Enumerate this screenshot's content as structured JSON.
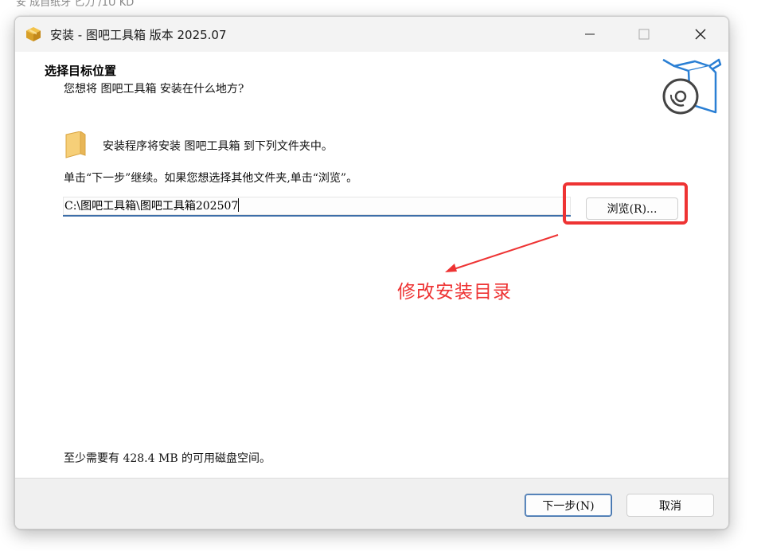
{
  "background_fragment": "安                   成自纸牙                        匕力 /1U KD",
  "window": {
    "title": "安装 - 图吧工具箱 版本 2025.07",
    "controls": {
      "minimize": "—",
      "close": "✕"
    }
  },
  "header": {
    "heading": "选择目标位置",
    "subheading": "您想将 图吧工具箱 安装在什么地方?"
  },
  "content": {
    "install_message": "安装程序将安装 图吧工具箱 到下列文件夹中。",
    "click_message": "单击“下一步”继续。如果您想选择其他文件夹,单击“浏览”。",
    "path_value": "C:\\图吧工具箱\\图吧工具箱202507",
    "browse_label": "浏览(R)...",
    "annotation": "修改安装目录",
    "disk_space": "至少需要有 428.4 MB 的可用磁盘空间。"
  },
  "footer": {
    "next_label": "下一步(N)",
    "cancel_label": "取消"
  },
  "colors": {
    "annotation_red": "#ee3333",
    "input_underline": "#3d6ea8",
    "setup_blue": "#2a7fd4"
  }
}
